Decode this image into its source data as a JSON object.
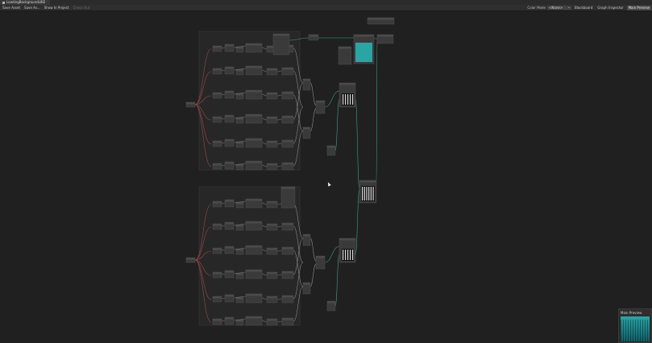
{
  "window": {
    "tab_title": "LoadingBackgroundLIKE"
  },
  "toolbar": {
    "save_asset": "Save Asset",
    "save_as": "Save As...",
    "show_in_project": "Show In Project",
    "check_out": "Check Out",
    "color_mode_label": "Color Mode",
    "color_mode_value": "<None>",
    "blackboard": "Blackboard",
    "graph_inspector": "Graph Inspector",
    "main_preview": "Main Preview"
  },
  "preview": {
    "title": "Main Preview"
  },
  "colors": {
    "background": "#202020",
    "node_body": "#3a3a3a",
    "node_header": "#4b4b4b",
    "edge_red": "#9c4a4a",
    "edge_teal": "#3c9c8a",
    "preview_teal": "#2aa5a5"
  }
}
